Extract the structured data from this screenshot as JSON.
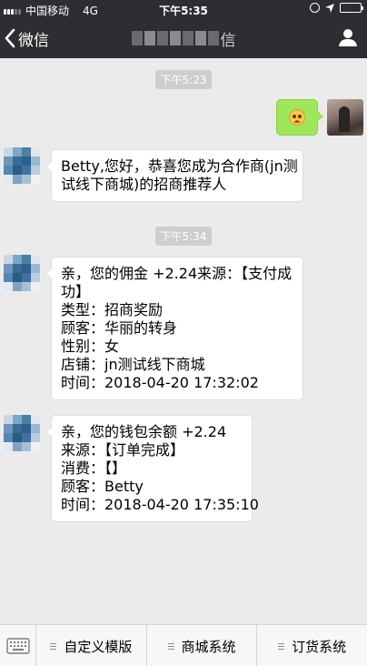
{
  "status_bar": {
    "carrier": "中国移动",
    "network": "4G",
    "time": "下午5:35"
  },
  "nav": {
    "back_label": "微信",
    "title_fragment_visible": "信"
  },
  "messages": [
    {
      "type": "timestamp",
      "text": "下午5:23"
    },
    {
      "type": "sent",
      "content": "emoji",
      "emoji_icon": "angry-face-icon"
    },
    {
      "type": "received",
      "lines": [
        "Betty,您好，恭喜您成为合作商(jn测",
        "试线下商城)的招商推荐人"
      ]
    },
    {
      "type": "timestamp",
      "text": "下午5:34"
    },
    {
      "type": "received",
      "lines": [
        "亲，您的佣金 +2.24来源：【支付成",
        "功】",
        "类型：招商奖励",
        "顾客：华丽的转身",
        "性别：女",
        "店铺：jn测试线下商城",
        "时间：2018-04-20 17:32:02"
      ]
    },
    {
      "type": "received",
      "lines": [
        "亲，您的钱包余额 +2.24",
        "来源：【订单完成】",
        "消费：【】",
        "顾客：Betty",
        "时间：2018-04-20 17:35:10"
      ]
    }
  ],
  "bottom_menu": {
    "keyboard_icon": "keyboard-icon",
    "items": [
      "自定义模版",
      "商城系统",
      "订货系统"
    ]
  },
  "colors": {
    "nav_bg": "#2e2e32",
    "chat_bg": "#ebebeb",
    "sent_bubble": "#9fe65a",
    "received_bubble": "#ffffff"
  }
}
